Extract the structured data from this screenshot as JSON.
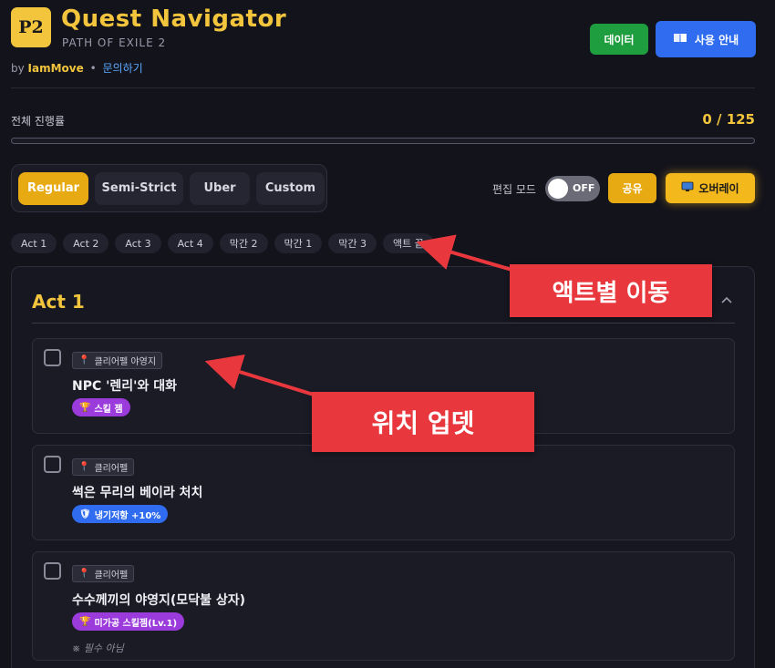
{
  "header": {
    "logo_text": "P2",
    "title": "Quest Navigator",
    "subtitle": "PATH OF EXILE 2",
    "by_prefix": "by",
    "author": "IamMove",
    "separator": "•",
    "contact_label": "문의하기",
    "data_button": "데이터",
    "guide_button": "사용 안내",
    "guide_icon": "book-icon"
  },
  "progress": {
    "label": "전체 진행률",
    "value_text": "0 / 125",
    "completed": 0,
    "total": 125
  },
  "modes": {
    "items": [
      "Regular",
      "Semi-Strict",
      "Uber",
      "Custom"
    ],
    "active": "Regular"
  },
  "toolbar": {
    "edit_label": "편집 모드",
    "toggle_state": "OFF",
    "share_label": "공유",
    "overlay_label": "오버레이",
    "overlay_icon": "monitor-icon"
  },
  "act_nav": [
    "Act 1",
    "Act 2",
    "Act 3",
    "Act 4",
    "막간 2",
    "막간 1",
    "막간 3",
    "액트 끝"
  ],
  "section": {
    "title": "Act 1",
    "collapse_icon": "chevron-up-icon"
  },
  "quests": [
    {
      "location": "클리어펠 야영지",
      "title": "NPC '렌리'와 대화",
      "tag": "스킬 젬",
      "tag_icon": "trophy-icon",
      "tag_color": "#9b3bdc",
      "note": ""
    },
    {
      "location": "클리어펠",
      "title": "썩은 무리의 베이라 처치",
      "tag": "냉기저항 +10%",
      "tag_icon": "shield-icon",
      "tag_color": "#2f6cf0",
      "note": ""
    },
    {
      "location": "클리어펠",
      "title": "수수께끼의 야영지(모닥불 상자)",
      "tag": "미가공 스킬젬(Lv.1)",
      "tag_icon": "trophy-icon",
      "tag_color": "#9b3bdc",
      "note": "※ 필수 아님"
    }
  ],
  "annotations": {
    "act_move": "액트별 이동",
    "location_update": "위치 업뎃",
    "color": "#e8383d"
  }
}
